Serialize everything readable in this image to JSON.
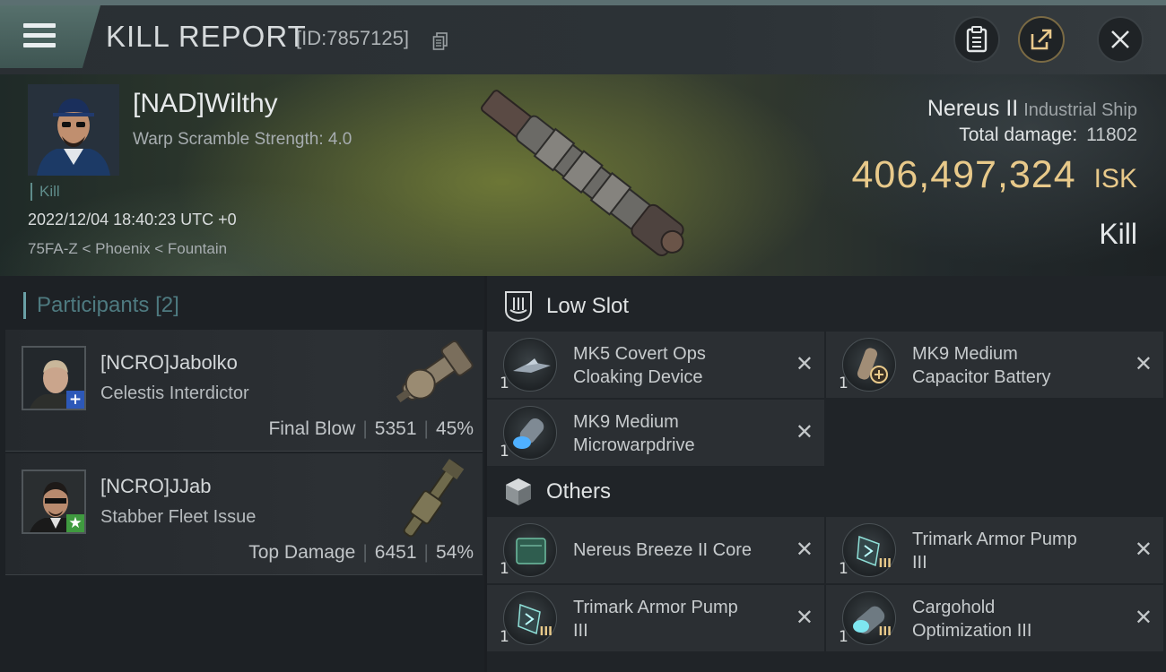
{
  "header": {
    "title": "KILL REPORT",
    "report_id": "[ID:7857125]",
    "icons": [
      "menu-icon",
      "copy-icon",
      "clipboard-icon",
      "share-icon",
      "close-icon"
    ]
  },
  "victim": {
    "name": "[NAD]Wilthy",
    "warp_scramble": "Warp Scramble Strength: 4.0",
    "tag": "Kill",
    "datetime": "2022/12/04 18:40:23 UTC +0",
    "location": "75FA-Z < Phoenix < Fountain",
    "ship_name": "Nereus II",
    "ship_class": "Industrial Ship",
    "total_damage_label": "Total damage:",
    "total_damage": "11802",
    "isk_value": "406,497,324",
    "isk_unit": "ISK",
    "result": "Kill"
  },
  "participants": {
    "label": "Participants",
    "count": "[2]",
    "items": [
      {
        "name": "[NCRO]Jabolko",
        "ship": "Celestis Interdictor",
        "role": "Final Blow",
        "damage": "5351",
        "percent": "45%",
        "badge_icon": "plus-icon",
        "badge_color": "#2d58b8"
      },
      {
        "name": "[NCRO]JJab",
        "ship": "Stabber Fleet Issue",
        "role": "Top Damage",
        "damage": "6451",
        "percent": "54%",
        "badge_icon": "star-icon",
        "badge_color": "#3f9a3f"
      }
    ]
  },
  "fittings": {
    "low_slot": {
      "label": "Low Slot",
      "icon": "low-slot-icon",
      "items": [
        {
          "qty": "1",
          "line1": "MK5 Covert Ops",
          "line2": "Cloaking Device"
        },
        {
          "qty": "1",
          "line1": "MK9 Medium",
          "line2": "Capacitor Battery"
        },
        {
          "qty": "1",
          "line1": "MK9 Medium",
          "line2": "Microwarpdrive"
        }
      ]
    },
    "others": {
      "label": "Others",
      "icon": "cube-icon",
      "items": [
        {
          "qty": "1",
          "line1": "Nereus Breeze II Core",
          "line2": ""
        },
        {
          "qty": "1",
          "line1": "Trimark Armor Pump",
          "line2": "III"
        },
        {
          "qty": "1",
          "line1": "Trimark Armor Pump",
          "line2": "III"
        },
        {
          "qty": "1",
          "line1": "Cargohold",
          "line2": "Optimization III"
        }
      ]
    }
  },
  "colors": {
    "accent_teal": "#6aa0a6",
    "isk_gold": "#e8c98a",
    "panel_dark": "#1d2125"
  }
}
